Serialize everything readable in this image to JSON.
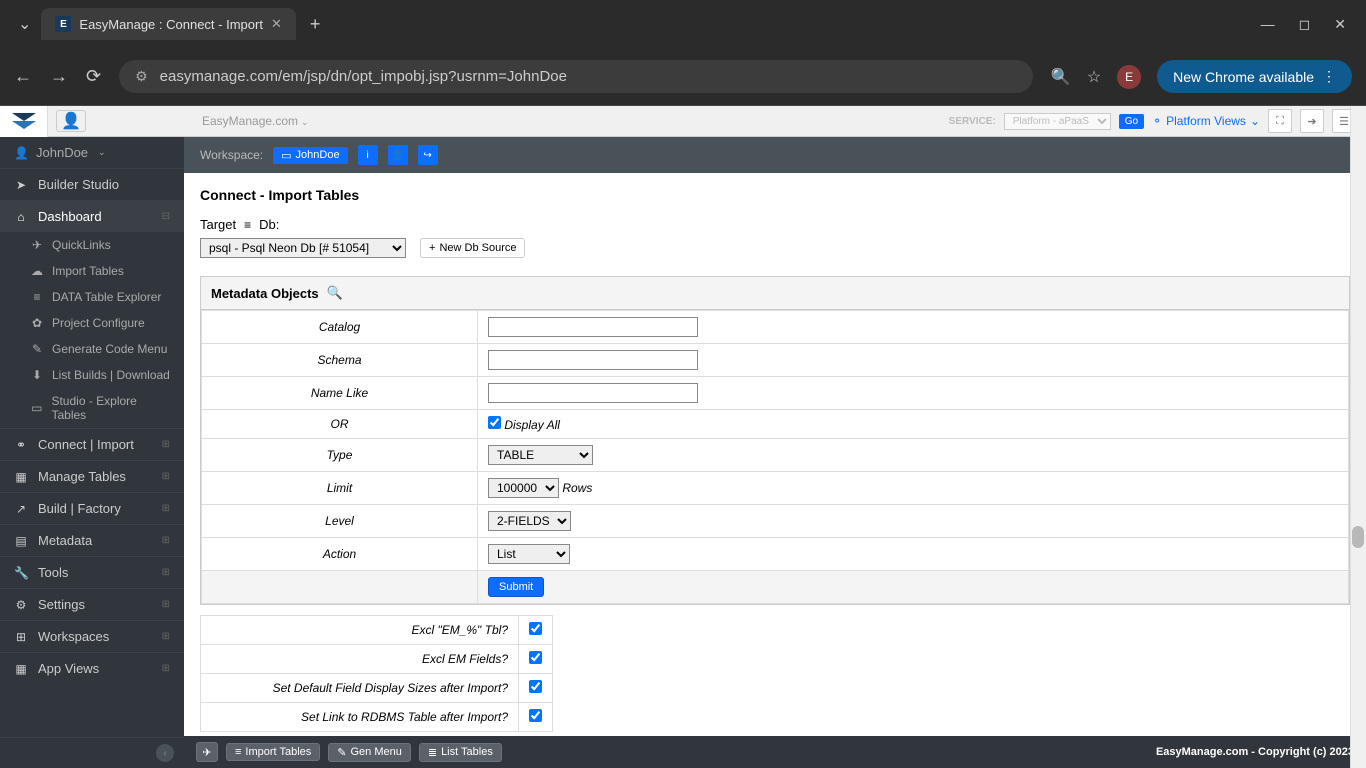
{
  "browser": {
    "tab_title": "EasyManage : Connect - Import",
    "url": "easymanage.com/em/jsp/dn/opt_impobj.jsp?usrnm=JohnDoe",
    "avatar_letter": "E",
    "chrome_update": "New Chrome available"
  },
  "topbar": {
    "breadcrumb": "EasyManage.com",
    "service_label": "SERVICE:",
    "service_value": "Platform - aPaaS",
    "go": "Go",
    "platform_views": "Platform Views"
  },
  "sidebar": {
    "user": "JohnDoe",
    "builder": "Builder Studio",
    "dashboard": "Dashboard",
    "subs": {
      "quicklinks": "QuickLinks",
      "import_tables": "Import Tables",
      "data_explorer": "DATA Table Explorer",
      "project_config": "Project Configure",
      "gen_code": "Generate Code Menu",
      "list_builds": "List Builds | Download",
      "studio_explore": "Studio - Explore Tables"
    },
    "items": {
      "connect": "Connect | Import",
      "manage_tables": "Manage Tables",
      "build": "Build | Factory",
      "metadata": "Metadata",
      "tools": "Tools",
      "settings": "Settings",
      "workspaces": "Workspaces",
      "app_views": "App Views"
    }
  },
  "workspace": {
    "label": "Workspace:",
    "user": "JohnDoe"
  },
  "page": {
    "title": "Connect - Import Tables",
    "target_label": "Target",
    "db_label": "Db:",
    "db_select": "psql - Psql Neon Db [# 51054]",
    "new_db": "New Db Source",
    "meta_header": "Metadata Objects",
    "form": {
      "catalog": "Catalog",
      "schema": "Schema",
      "name_like": "Name Like",
      "or": "OR",
      "display_all": "Display All",
      "type": "Type",
      "type_value": "TABLE",
      "limit": "Limit",
      "limit_value": "100000",
      "rows": "Rows",
      "level": "Level",
      "level_value": "2-FIELDS",
      "action": "Action",
      "action_value": "List",
      "submit": "Submit"
    },
    "options": {
      "excl_em_tbl": "Excl \"EM_%\" Tbl?",
      "excl_em_fields": "Excl EM Fields?",
      "set_default": "Set Default Field Display Sizes after Import?",
      "set_link": "Set Link to RDBMS Table after Import?"
    }
  },
  "footer": {
    "import_tables": "Import Tables",
    "gen_menu": "Gen Menu",
    "list_tables": "List Tables",
    "copyright": "EasyManage.com - Copyright (c) 2023"
  }
}
